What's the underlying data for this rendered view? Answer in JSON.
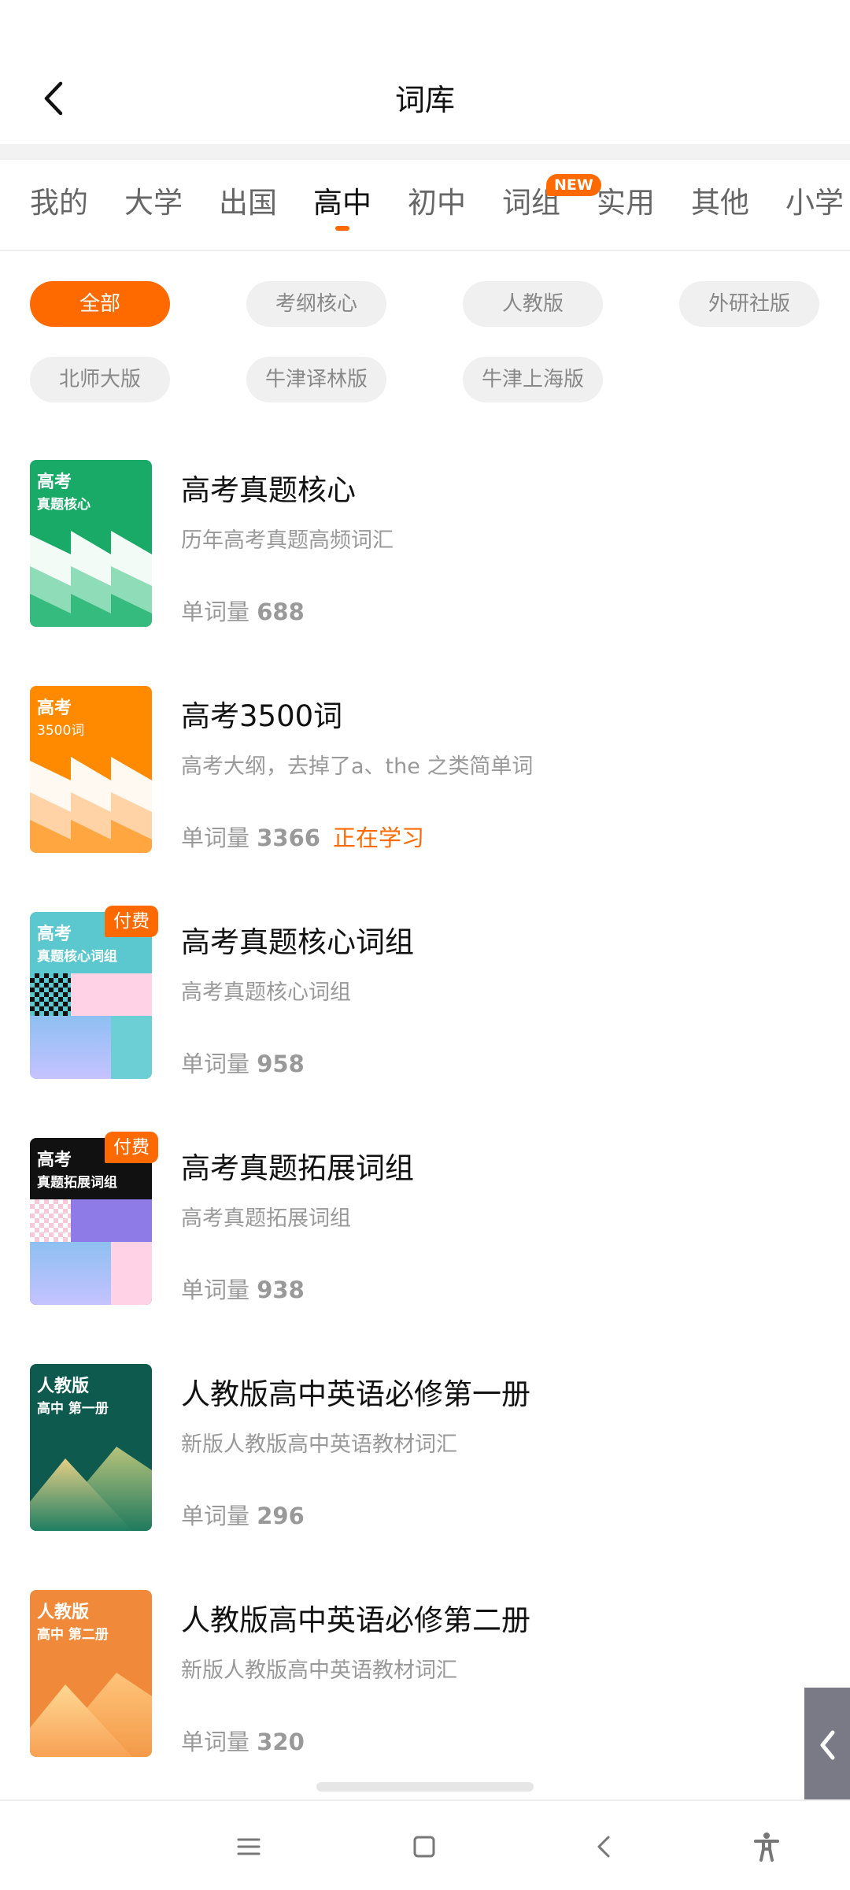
{
  "header": {
    "title": "词库"
  },
  "tabs": [
    {
      "label": "我的"
    },
    {
      "label": "大学"
    },
    {
      "label": "出国"
    },
    {
      "label": "高中"
    },
    {
      "label": "初中"
    },
    {
      "label": "词组"
    },
    {
      "label": "实用"
    },
    {
      "label": "其他"
    },
    {
      "label": "小学"
    }
  ],
  "active_tab": "高中",
  "new_badge": "NEW",
  "filters": [
    {
      "label": "全部"
    },
    {
      "label": "考纲核心"
    },
    {
      "label": "人教版"
    },
    {
      "label": "外研社版"
    },
    {
      "label": "北师大版"
    },
    {
      "label": "牛津译林版"
    },
    {
      "label": "牛津上海版"
    }
  ],
  "active_filter": "全部",
  "word_count_label": "单词量",
  "paid_label": "付费",
  "books": [
    {
      "title": "高考真题核心",
      "desc": "历年高考真题高频词汇",
      "count": "688",
      "cover_line1": "高考",
      "cover_line2": "真题核心"
    },
    {
      "title": "高考3500词",
      "desc": "高考大纲，去掉了a、the 之类简单词",
      "count": "3366",
      "status": "正在学习",
      "cover_line1": "高考",
      "cover_line2": "3500词"
    },
    {
      "title": "高考真题核心词组",
      "desc": "高考真题核心词组",
      "count": "958",
      "cover_line1": "高考",
      "cover_line2": "真题核心词组"
    },
    {
      "title": "高考真题拓展词组",
      "desc": "高考真题拓展词组",
      "count": "938",
      "cover_line1": "高考",
      "cover_line2": "真题拓展词组"
    },
    {
      "title": "人教版高中英语必修第一册",
      "desc": "新版人教版高中英语教材词汇",
      "count": "296",
      "cover_line1": "人教版",
      "cover_line2": "高中 第一册"
    },
    {
      "title": "人教版高中英语必修第二册",
      "desc": "新版人教版高中英语教材词汇",
      "count": "320",
      "cover_line1": "人教版",
      "cover_line2": "高中 第二册"
    }
  ],
  "colors": {
    "accent": "#ff6a00",
    "cover_green": "#1aaa68",
    "cover_orange": "#ff8a00",
    "cover_teal": "#5bc8cf",
    "cover_black": "#111111",
    "cover_darkgreen": "#0e5a4e",
    "cover_peach": "#f08a3a"
  },
  "icons": {
    "back": "chevron-left-icon",
    "side": "chevron-left-icon",
    "nav": [
      "menu-icon",
      "home-icon",
      "back-icon",
      "accessibility-icon"
    ]
  }
}
